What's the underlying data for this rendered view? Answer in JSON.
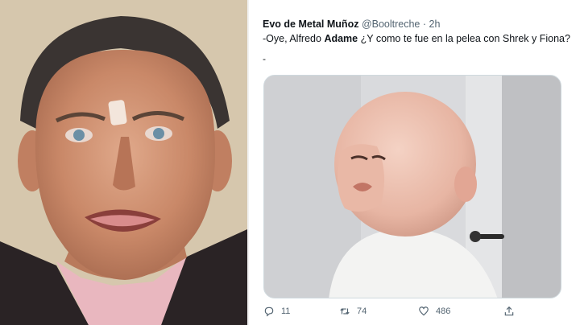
{
  "tweet": {
    "author_name": "Evo de Metal Muñoz",
    "author_handle": "@Booltreche",
    "separator": "·",
    "time": "2h",
    "text_before": "-Oye, Alfredo ",
    "text_bold": "Adame",
    "text_after": " ¿Y como te fue en la pelea con Shrek y Fiona?",
    "text_extra": "-",
    "replies": "11",
    "retweets": "74",
    "likes": "486"
  },
  "icons": [
    "reply-icon",
    "retweet-icon",
    "like-icon",
    "share-icon"
  ],
  "colors": {
    "text": "#0f1419",
    "muted": "#536471",
    "border": "#cfd9de"
  }
}
